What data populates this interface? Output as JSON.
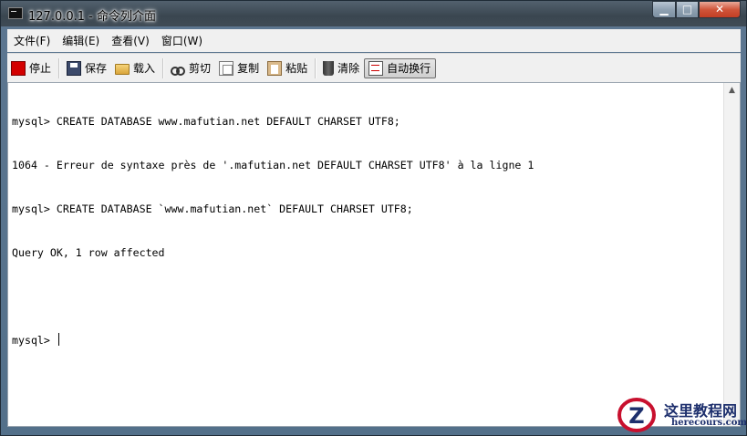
{
  "window": {
    "title": "127.0.0.1 - 命令列介面",
    "minimize_glyph": "▁",
    "maximize_glyph": "□",
    "close_glyph": "✕"
  },
  "menu": [
    "文件(F)",
    "编辑(E)",
    "查看(V)",
    "窗口(W)"
  ],
  "toolbar": {
    "stop": "停止",
    "save": "保存",
    "load": "载入",
    "cut": "剪切",
    "copy": "复制",
    "paste": "粘贴",
    "clear": "清除",
    "wrap": "自动换行"
  },
  "terminal": {
    "lines": [
      "mysql> CREATE DATABASE www.mafutian.net DEFAULT CHARSET UTF8;",
      "1064 - Erreur de syntaxe près de '.mafutian.net DEFAULT CHARSET UTF8' à la ligne 1",
      "mysql> CREATE DATABASE `www.mafutian.net` DEFAULT CHARSET UTF8;",
      "Query OK, 1 row affected",
      "",
      "mysql> "
    ]
  },
  "watermark": {
    "main": "这里教程网",
    "sub": "herecours.com",
    "logo_letter": "Z"
  },
  "colors": {
    "accent_red": "#d30000",
    "watermark_blue": "#1d2f6d"
  }
}
